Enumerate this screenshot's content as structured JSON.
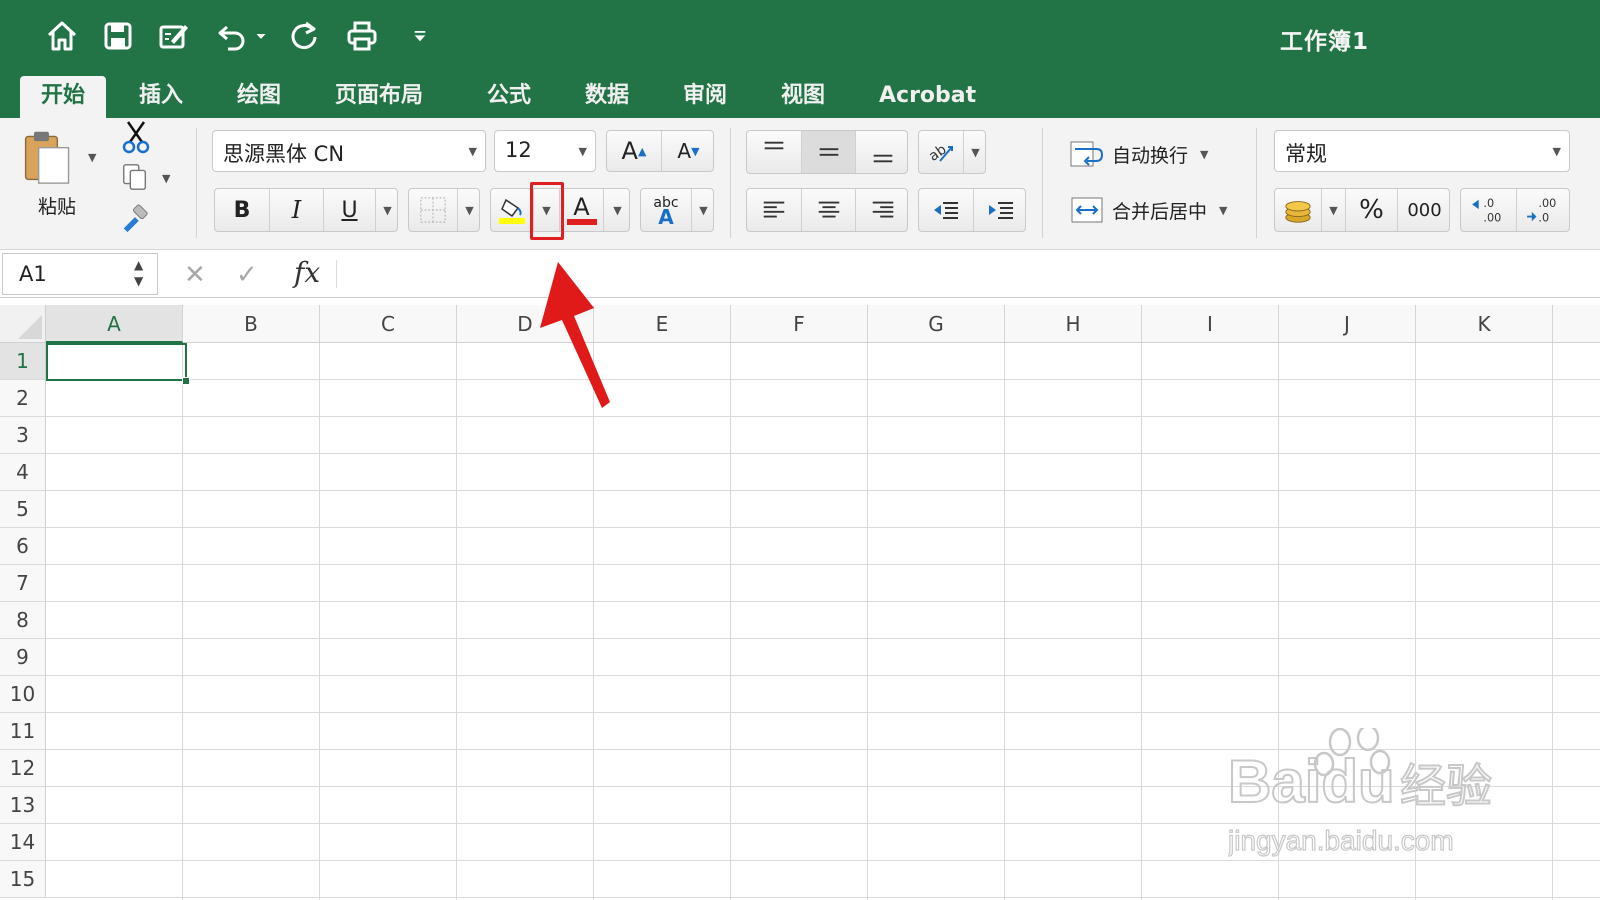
{
  "window": {
    "title": "工作簿1"
  },
  "quick_access": {
    "icons": [
      "home-icon",
      "save-icon",
      "edit-icon",
      "undo-icon",
      "redo-icon",
      "print-icon",
      "customize-icon"
    ]
  },
  "tabs": [
    {
      "label": "开始",
      "active": true
    },
    {
      "label": "插入",
      "active": false
    },
    {
      "label": "绘图",
      "active": false
    },
    {
      "label": "页面布局",
      "active": false
    },
    {
      "label": "公式",
      "active": false
    },
    {
      "label": "数据",
      "active": false
    },
    {
      "label": "审阅",
      "active": false
    },
    {
      "label": "视图",
      "active": false
    },
    {
      "label": "Acrobat",
      "active": false
    }
  ],
  "ribbon": {
    "paste_label": "粘贴",
    "font_name": "思源黑体 CN",
    "font_size": "12",
    "grow_font": "A",
    "shrink_font": "A",
    "bold": "B",
    "italic": "I",
    "underline": "U",
    "font_color_letter": "A",
    "phonetic_small": "abc",
    "phonetic_big": "A",
    "fill_color": "#ffff00",
    "font_color": "#e02020",
    "wrap_text": "自动换行",
    "merge_center": "合并后居中",
    "number_format": "常规",
    "percent": "%",
    "comma": "000",
    "increase_decimal": ".0\n.00",
    "decrease_decimal": ".00\n.0"
  },
  "formula_bar": {
    "name_box": "A1",
    "fx": "fx",
    "formula": ""
  },
  "sheet": {
    "columns": [
      "A",
      "B",
      "C",
      "D",
      "E",
      "F",
      "G",
      "H",
      "I",
      "J",
      "K"
    ],
    "rows": [
      "1",
      "2",
      "3",
      "4",
      "5",
      "6",
      "7",
      "8",
      "9",
      "10",
      "11",
      "12",
      "13",
      "14",
      "15"
    ],
    "active_cell": "A1"
  },
  "annotation": {
    "highlight_color": "#e02020",
    "arrow_color": "#e01919",
    "target": "fill-color-dropdown"
  },
  "watermark": {
    "line1": "Baidu经验",
    "line2": "jingyan.baidu.com"
  },
  "theme": {
    "accent": "#227346",
    "ribbon_bg": "#f3f3f3"
  }
}
